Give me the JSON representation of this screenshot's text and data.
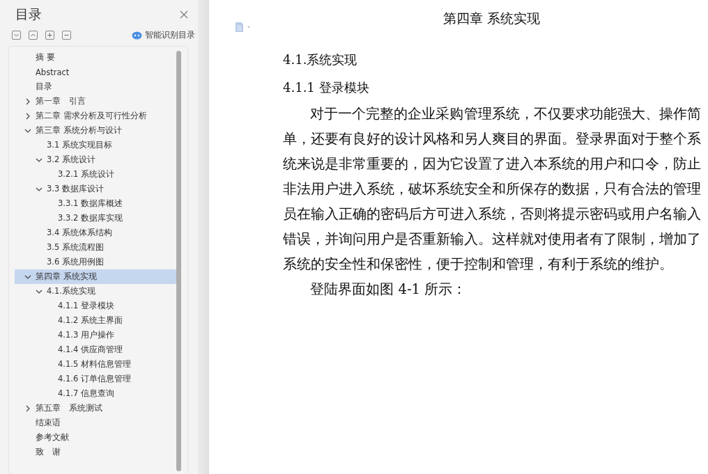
{
  "sidebar": {
    "title": "目录",
    "smart_toc": {
      "label": "智能识别目录"
    },
    "items": [
      {
        "label": "摘 要",
        "selected": false
      },
      {
        "label": "Abstract",
        "selected": false
      },
      {
        "label": "目录",
        "selected": false
      },
      {
        "label": "第一章　引言",
        "selected": false,
        "expanded": false
      },
      {
        "label": "第二章 需求分析及可行性分析",
        "selected": false,
        "expanded": false
      },
      {
        "label": "第三章 系统分析与设计",
        "selected": false,
        "expanded": true,
        "children": [
          {
            "label": "3.1 系统实现目标",
            "selected": false
          },
          {
            "label": "3.2  系统设计",
            "selected": false,
            "expanded": true,
            "children": [
              {
                "label": "3.2.1 系统设计",
                "selected": false
              }
            ]
          },
          {
            "label": "3.3 数据库设计",
            "selected": false,
            "expanded": true,
            "children": [
              {
                "label": "3.3.1 数据库概述",
                "selected": false
              },
              {
                "label": "3.3.2 数据库实现",
                "selected": false
              }
            ]
          },
          {
            "label": "3.4 系统体系结构",
            "selected": false
          },
          {
            "label": "3.5 系统流程图",
            "selected": false
          },
          {
            "label": "3.6 系统用例图",
            "selected": false
          }
        ]
      },
      {
        "label": "第四章 系统实现",
        "selected": true,
        "expanded": true,
        "children": [
          {
            "label": "4.1.系统实现",
            "selected": false,
            "expanded": true,
            "children": [
              {
                "label": "4.1.1  登录模块",
                "selected": false
              },
              {
                "label": "4.1.2 系统主界面",
                "selected": false
              },
              {
                "label": "4.1.3 用户操作",
                "selected": false
              },
              {
                "label": "4.1.4 供应商管理",
                "selected": false
              },
              {
                "label": "4.1.5 材料信息管理",
                "selected": false
              },
              {
                "label": "4.1.6 订单信息管理",
                "selected": false
              },
              {
                "label": "4.1.7 信息查询",
                "selected": false
              }
            ]
          }
        ]
      },
      {
        "label": "第五章　系统测试",
        "selected": false,
        "expanded": false
      },
      {
        "label": "结束语",
        "selected": false
      },
      {
        "label": "参考文献",
        "selected": false
      },
      {
        "label": "致　谢",
        "selected": false
      }
    ]
  },
  "document": {
    "chapter_title": "第四章 系统实现",
    "blocks": [
      {
        "kind": "heading",
        "text": "4.1.系统实现"
      },
      {
        "kind": "heading",
        "text": "4.1.1 登录模块"
      },
      {
        "kind": "paragraph",
        "text": "对于一个完整的企业采购管理系统，不仅要求功能强大、操作简单，还要有良好的设计风格和另人爽目的界面。登录界面对于整个系统来说是非常重要的，因为它设置了进入本系统的用户和口令，防止非法用户进入系统，破坏系统安全和所保存的数据，只有合法的管理员在输入正确的密码后方可进入系统，否则将提示密码或用户名输入错误，并询问用户是否重新输入。这样就对使用者有了限制，增加了系统的安全性和保密性，便于控制和管理，有利于系统的维护。"
      },
      {
        "kind": "paragraph",
        "text": "登陆界面如图 4-1 所示："
      }
    ]
  }
}
